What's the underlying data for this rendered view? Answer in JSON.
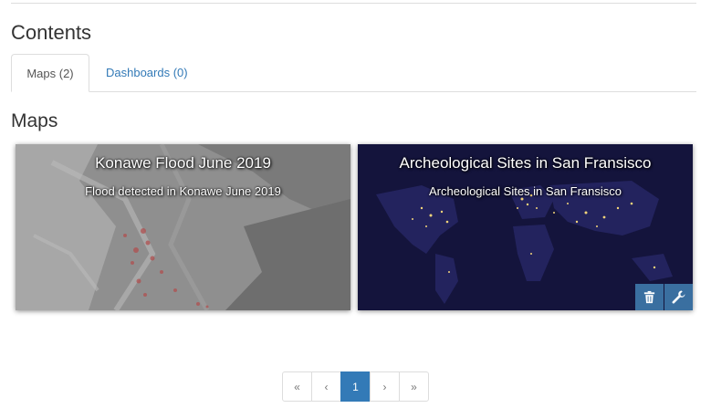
{
  "header": {
    "title": "Contents"
  },
  "tabs": [
    {
      "label": "Maps (2)",
      "active": true
    },
    {
      "label": "Dashboards (0)",
      "active": false
    }
  ],
  "maps_section": {
    "title": "Maps"
  },
  "maps": [
    {
      "title": "Konawe Flood June 2019",
      "description": "Flood detected in Konawe June 2019",
      "thumbnail": "grayscale terrain with red flood patches"
    },
    {
      "title": "Archeological Sites in San Fransisco",
      "description": "Archeological Sites in San Fransisco",
      "thumbnail": "world at night",
      "actions": [
        "trash-icon",
        "wrench-icon"
      ]
    }
  ],
  "pagination": {
    "first": "«",
    "prev": "‹",
    "current": "1",
    "next": "›",
    "last": "»"
  },
  "colors": {
    "link": "#337ab7",
    "action_button": "#3a6fa0"
  }
}
